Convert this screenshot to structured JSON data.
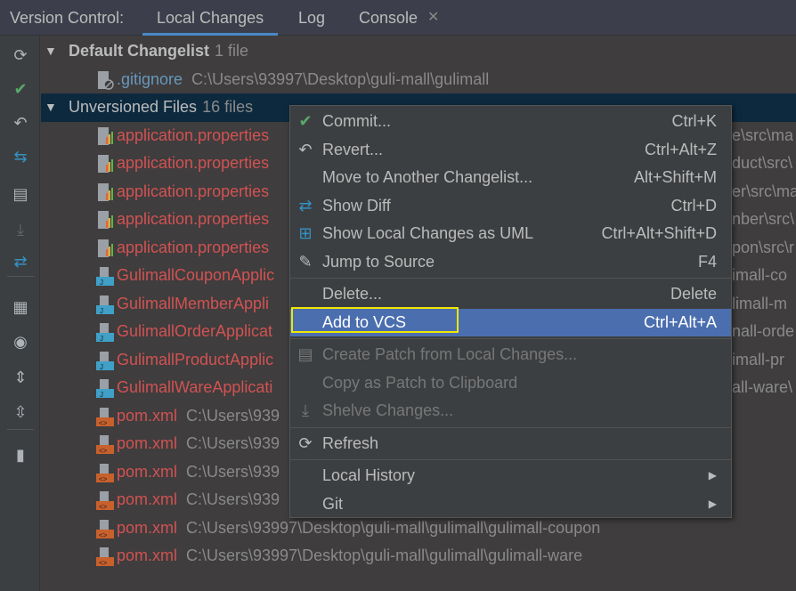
{
  "tabs": {
    "prefix": "Version Control:",
    "items": [
      "Local Changes",
      "Log",
      "Console"
    ],
    "active": "Local Changes",
    "close_glyph": "✕"
  },
  "toolbar": [
    "refresh-icon",
    "commit-check-icon",
    "rollback-icon",
    "show-diff-icon",
    "changelist-icon",
    "shelve-icon",
    "uml-diff-icon",
    "group-by-icon",
    "view-options-icon",
    "expand-all-icon",
    "collapse-all-icon",
    "preview-panel-icon"
  ],
  "groups": [
    {
      "name": "Default Changelist",
      "count": "1 file"
    },
    {
      "name": "Unversioned Files",
      "count": "16 files"
    }
  ],
  "default_files": [
    {
      "name": ".gitignore",
      "path": "C:\\Users\\93997\\Desktop\\guli-mall\\gulimall",
      "color": "#6897bb",
      "icon": "ignored"
    }
  ],
  "unversioned_files": [
    {
      "name": "application.properties",
      "path": "",
      "tail": "e\\src\\ma",
      "icon": "properties"
    },
    {
      "name": "application.properties",
      "path": "",
      "tail": "duct\\src\\",
      "icon": "properties"
    },
    {
      "name": "application.properties",
      "path": "",
      "tail": "er\\src\\ma",
      "icon": "properties"
    },
    {
      "name": "application.properties",
      "path": "",
      "tail": "nber\\src\\",
      "icon": "properties"
    },
    {
      "name": "application.properties",
      "path": "",
      "tail": "pon\\src\\r",
      "icon": "properties"
    },
    {
      "name": "GulimallCouponApplic",
      "path": "",
      "tail": "imall-co",
      "icon": "java"
    },
    {
      "name": "GulimallMemberAppli",
      "path": "",
      "tail": "limall-m",
      "icon": "java"
    },
    {
      "name": "GulimallOrderApplicat",
      "path": "",
      "tail": "nall-orde",
      "icon": "java"
    },
    {
      "name": "GulimallProductApplic",
      "path": "",
      "tail": "imall-pr",
      "icon": "java"
    },
    {
      "name": "GulimallWareApplicati",
      "path": "",
      "tail": "all-ware\\",
      "icon": "java"
    },
    {
      "name": "pom.xml",
      "path": "C:\\Users\\939",
      "tail": "",
      "icon": "xml"
    },
    {
      "name": "pom.xml",
      "path": "C:\\Users\\939",
      "tail": "",
      "icon": "xml"
    },
    {
      "name": "pom.xml",
      "path": "C:\\Users\\939",
      "tail": "",
      "icon": "xml"
    },
    {
      "name": "pom.xml",
      "path": "C:\\Users\\939",
      "tail": "",
      "icon": "xml"
    },
    {
      "name": "pom.xml",
      "path": "C:\\Users\\93997\\Desktop\\guli-mall\\gulimall\\gulimall-coupon",
      "tail": "",
      "icon": "xml"
    },
    {
      "name": "pom.xml",
      "path": "C:\\Users\\93997\\Desktop\\guli-mall\\gulimall\\gulimall-ware",
      "tail": "",
      "icon": "xml"
    }
  ],
  "unversioned_color": "#d25252",
  "menu": [
    {
      "label": "Commit...",
      "shortcut": "Ctrl+K",
      "icon": "✔",
      "icon_name": "check-icon",
      "icon_color": "#59a869"
    },
    {
      "label": "Revert...",
      "shortcut": "Ctrl+Alt+Z",
      "icon": "↶",
      "icon_name": "revert-icon"
    },
    {
      "label": "Move to Another Changelist...",
      "shortcut": "Alt+Shift+M"
    },
    {
      "label": "Show Diff",
      "shortcut": "Ctrl+D",
      "icon": "⇄",
      "icon_name": "diff-icon",
      "icon_color": "#3592c4"
    },
    {
      "label": "Show Local Changes as UML",
      "shortcut": "Ctrl+Alt+Shift+D",
      "icon": "⊞",
      "icon_name": "uml-icon",
      "icon_color": "#3592c4"
    },
    {
      "label": "Jump to Source",
      "shortcut": "F4",
      "icon": "✎",
      "icon_name": "edit-icon"
    },
    {
      "sep": true
    },
    {
      "label": "Delete...",
      "shortcut": "Delete"
    },
    {
      "label": "Add to VCS",
      "shortcut": "Ctrl+Alt+A",
      "highlight": true
    },
    {
      "sep": true
    },
    {
      "label": "Create Patch from Local Changes...",
      "shortcut": "",
      "disabled": true,
      "icon": "▤",
      "icon_name": "patch-icon"
    },
    {
      "label": "Copy as Patch to Clipboard",
      "shortcut": "",
      "disabled": true
    },
    {
      "label": "Shelve Changes...",
      "shortcut": "",
      "disabled": true,
      "icon": "⤓",
      "icon_name": "shelve-icon"
    },
    {
      "sep": true
    },
    {
      "label": "Refresh",
      "shortcut": "",
      "icon": "⟳",
      "icon_name": "refresh-icon"
    },
    {
      "sep": true
    },
    {
      "label": "Local History",
      "shortcut": "▶",
      "submenu": true
    },
    {
      "label": "Git",
      "shortcut": "▶",
      "submenu": true
    }
  ]
}
